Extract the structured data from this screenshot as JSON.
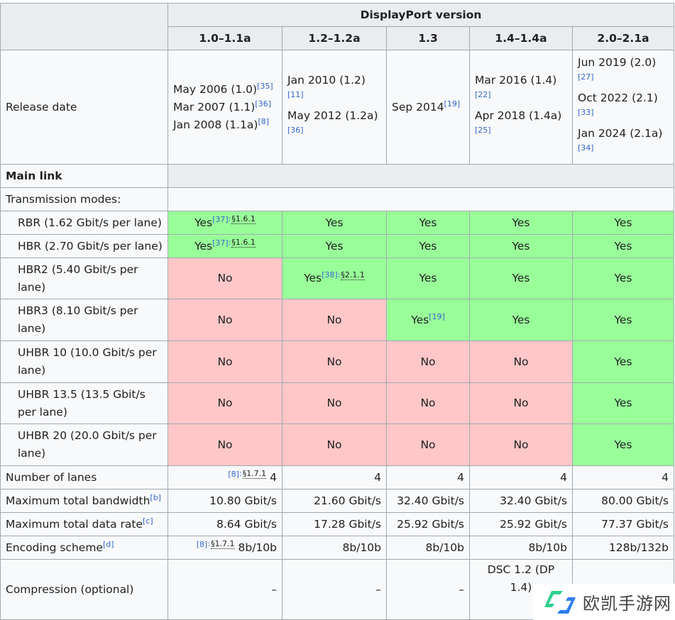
{
  "header": {
    "group": "DisplayPort version",
    "versions": [
      "1.0–1.1a",
      "1.2–1.2a",
      "1.3",
      "1.4–1.4a",
      "2.0–2.1a"
    ]
  },
  "release": {
    "label": "Release date",
    "cells": [
      [
        [
          "May 2006 (1.0)",
          "[35]"
        ],
        [
          "Mar 2007 (1.1)",
          "[36]"
        ],
        [
          "Jan 2008 (1.1a)",
          "[8]"
        ]
      ],
      [
        [
          "Jan 2010 (1.2)",
          "[11]"
        ],
        [
          "May 2012 (1.2a)",
          "[36]"
        ]
      ],
      [
        [
          "Sep 2014",
          "[19]"
        ]
      ],
      [
        [
          "Mar 2016 (1.4)",
          "[22]"
        ],
        [
          "Apr 2018 (1.4a)",
          "[25]"
        ]
      ],
      [
        [
          "Jun 2019 (2.0)",
          "[27]"
        ],
        [
          "Oct 2022 (2.1)",
          "[33]"
        ],
        [
          "Jan 2024 (2.1a)",
          "[34]"
        ]
      ]
    ]
  },
  "main_link": "Main link",
  "transmission_modes": "Transmission modes:",
  "modes": [
    {
      "label": "RBR (1.62 Gbit/s per lane)",
      "cells": [
        {
          "v": "Yes",
          "ref": "[37]",
          "sec": "§1.6.1"
        },
        {
          "v": "Yes"
        },
        {
          "v": "Yes"
        },
        {
          "v": "Yes"
        },
        {
          "v": "Yes"
        }
      ]
    },
    {
      "label": "HBR (2.70 Gbit/s per lane)",
      "cells": [
        {
          "v": "Yes",
          "ref": "[37]",
          "sec": "§1.6.1"
        },
        {
          "v": "Yes"
        },
        {
          "v": "Yes"
        },
        {
          "v": "Yes"
        },
        {
          "v": "Yes"
        }
      ]
    },
    {
      "label": "HBR2 (5.40 Gbit/s per lane)",
      "cells": [
        {
          "v": "No"
        },
        {
          "v": "Yes",
          "ref": "[38]",
          "sec": "§2.1.1"
        },
        {
          "v": "Yes"
        },
        {
          "v": "Yes"
        },
        {
          "v": "Yes"
        }
      ]
    },
    {
      "label": "HBR3 (8.10 Gbit/s per lane)",
      "cells": [
        {
          "v": "No"
        },
        {
          "v": "No"
        },
        {
          "v": "Yes",
          "ref": "[19]"
        },
        {
          "v": "Yes"
        },
        {
          "v": "Yes"
        }
      ]
    },
    {
      "label": "UHBR 10 (10.0 Gbit/s per lane)",
      "cells": [
        {
          "v": "No"
        },
        {
          "v": "No"
        },
        {
          "v": "No"
        },
        {
          "v": "No"
        },
        {
          "v": "Yes"
        }
      ]
    },
    {
      "label": "UHBR 13.5 (13.5 Gbit/s per lane)",
      "cells": [
        {
          "v": "No"
        },
        {
          "v": "No"
        },
        {
          "v": "No"
        },
        {
          "v": "No"
        },
        {
          "v": "Yes"
        }
      ]
    },
    {
      "label": "UHBR 20 (20.0 Gbit/s per lane)",
      "cells": [
        {
          "v": "No"
        },
        {
          "v": "No"
        },
        {
          "v": "No"
        },
        {
          "v": "No"
        },
        {
          "v": "Yes"
        }
      ]
    }
  ],
  "stats": [
    {
      "label": "Number of lanes",
      "note": "",
      "cells": [
        {
          "v": "4",
          "ref": "[8]",
          "sec": "§1.7.1"
        },
        {
          "v": "4"
        },
        {
          "v": "4"
        },
        {
          "v": "4"
        },
        {
          "v": "4"
        }
      ]
    },
    {
      "label": "Maximum total bandwidth",
      "note": "[b]",
      "cells": [
        {
          "v": "10.80 Gbit/s"
        },
        {
          "v": "21.60 Gbit/s"
        },
        {
          "v": "32.40 Gbit/s"
        },
        {
          "v": "32.40 Gbit/s"
        },
        {
          "v": "80.00 Gbit/s"
        }
      ]
    },
    {
      "label": "Maximum total data rate",
      "note": "[c]",
      "cells": [
        {
          "v": "8.64 Gbit/s"
        },
        {
          "v": "17.28 Gbit/s"
        },
        {
          "v": "25.92 Gbit/s"
        },
        {
          "v": "25.92 Gbit/s"
        },
        {
          "v": "77.37 Gbit/s"
        }
      ]
    },
    {
      "label": "Encoding scheme",
      "note": "[d]",
      "cells": [
        {
          "v": "8b/10b",
          "ref": "[8]",
          "sec": "§1.7.1"
        },
        {
          "v": "8b/10b"
        },
        {
          "v": "8b/10b"
        },
        {
          "v": "8b/10b"
        },
        {
          "v": "128b/132b"
        }
      ]
    }
  ],
  "compression": {
    "label": "Compression (optional)",
    "cells": [
      "–",
      "–",
      "–",
      "DSC 1.2 (DP 1.4)",
      ""
    ]
  },
  "watermark": "欧凯手游网",
  "colors": {
    "yes": "#99ff99",
    "no": "#ffc7c7",
    "header": "#eaecf0"
  }
}
